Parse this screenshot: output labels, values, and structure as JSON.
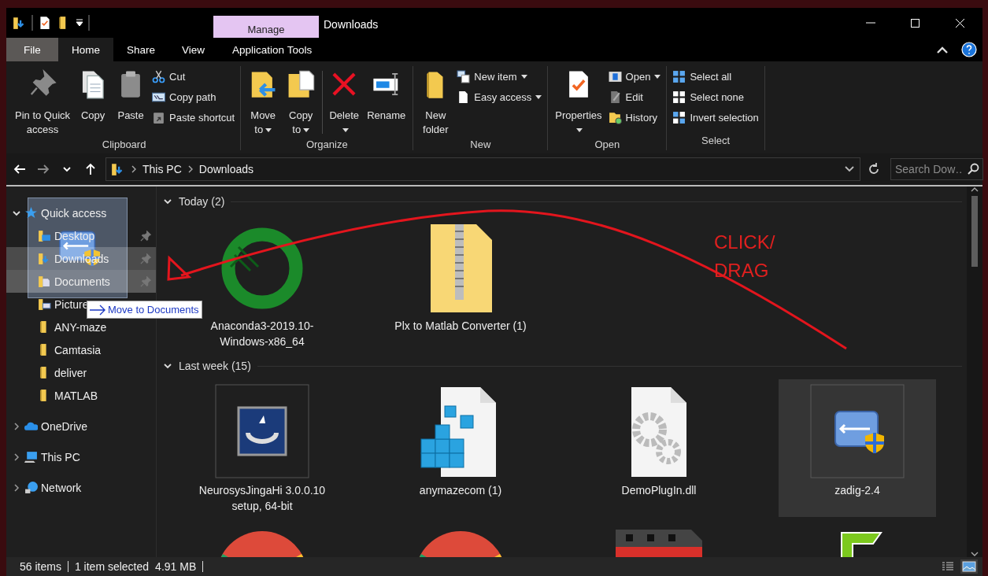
{
  "window": {
    "title": "Downloads",
    "contextual_tab": "Manage"
  },
  "ribbon_tabs": [
    {
      "label": "File",
      "kind": "file",
      "selected": false
    },
    {
      "label": "Home",
      "kind": "tab",
      "selected": true
    },
    {
      "label": "Share",
      "kind": "tab",
      "selected": false
    },
    {
      "label": "View",
      "kind": "tab",
      "selected": false
    },
    {
      "label": "Application Tools",
      "kind": "contextual",
      "selected": false
    }
  ],
  "ribbon_groups": [
    {
      "label": "Clipboard",
      "items": [
        {
          "kind": "large",
          "lines": [
            "Pin to Quick",
            "access"
          ]
        },
        {
          "kind": "large",
          "lines": [
            "Copy"
          ]
        },
        {
          "kind": "large",
          "lines": [
            "Paste"
          ]
        },
        {
          "kind": "small",
          "label": "Cut"
        },
        {
          "kind": "small",
          "label": "Copy path"
        },
        {
          "kind": "small",
          "label": "Paste shortcut"
        }
      ]
    },
    {
      "label": "Organize",
      "items": [
        {
          "kind": "large",
          "lines": [
            "Move",
            "to"
          ],
          "dropdown": true
        },
        {
          "kind": "large",
          "lines": [
            "Copy",
            "to"
          ],
          "dropdown": true
        },
        {
          "kind": "separator"
        },
        {
          "kind": "large",
          "lines": [
            "Delete"
          ],
          "dropdown": true
        },
        {
          "kind": "large",
          "lines": [
            "Rename"
          ]
        }
      ]
    },
    {
      "label": "New",
      "items": [
        {
          "kind": "large",
          "lines": [
            "New",
            "folder"
          ]
        },
        {
          "kind": "small",
          "label": "New item",
          "dropdown": true
        },
        {
          "kind": "small",
          "label": "Easy access",
          "dropdown": true
        }
      ]
    },
    {
      "label": "Open",
      "items": [
        {
          "kind": "large",
          "lines": [
            "Properties"
          ],
          "dropdown": true
        },
        {
          "kind": "small",
          "label": "Open",
          "dropdown": true
        },
        {
          "kind": "small",
          "label": "Edit"
        },
        {
          "kind": "small",
          "label": "History"
        }
      ]
    },
    {
      "label": "Select",
      "items": [
        {
          "kind": "small",
          "label": "Select all"
        },
        {
          "kind": "small",
          "label": "Select none"
        },
        {
          "kind": "small",
          "label": "Invert selection"
        }
      ]
    }
  ],
  "address_bar": {
    "path": [
      "This PC",
      "Downloads"
    ],
    "search_placeholder": "Search Dow…"
  },
  "navigation": [
    {
      "label": "Quick access",
      "expanded": true,
      "children": [
        {
          "label": "Desktop",
          "pinned": true,
          "selected": false,
          "drop_target": false
        },
        {
          "label": "Downloads",
          "pinned": true,
          "selected": true,
          "drop_target": false
        },
        {
          "label": "Documents",
          "pinned": true,
          "selected": false,
          "drop_target": true
        },
        {
          "label": "Picture",
          "pinned": false,
          "selected": false,
          "drop_target": false
        },
        {
          "label": "ANY-maze",
          "pinned": false,
          "selected": false,
          "drop_target": false
        },
        {
          "label": "Camtasia",
          "pinned": false,
          "selected": false,
          "drop_target": false
        },
        {
          "label": "deliver",
          "pinned": false,
          "selected": false,
          "drop_target": false
        },
        {
          "label": "MATLAB",
          "pinned": false,
          "selected": false,
          "drop_target": false
        }
      ]
    },
    {
      "label": "OneDrive",
      "expanded": false
    },
    {
      "label": "This PC",
      "expanded": false
    },
    {
      "label": "Network",
      "expanded": false
    }
  ],
  "file_groups": [
    {
      "label": "Today (2)",
      "expanded": true,
      "items": [
        {
          "name": "Anaconda3-2019.10-Windows-x86_64",
          "selected": false
        },
        {
          "name": "Plx to Matlab Converter (1)",
          "selected": false
        }
      ]
    },
    {
      "label": "Last week (15)",
      "expanded": true,
      "items": [
        {
          "name": "NeurosysJingaHi 3.0.0.10 setup, 64-bit",
          "selected": false
        },
        {
          "name": "anymazecom (1)",
          "selected": false
        },
        {
          "name": "DemoPlugIn.dll",
          "selected": false
        },
        {
          "name": "zadig-2.4",
          "selected": true
        },
        {
          "selected": false
        },
        {
          "selected": false
        },
        {
          "selected": false
        },
        {
          "selected": false
        }
      ]
    }
  ],
  "drag_tooltip": {
    "text": "Move to Documents"
  },
  "annotation": {
    "lines": [
      "CLICK/",
      "DRAG"
    ]
  },
  "status_bar": {
    "count": "56 items",
    "selection": "1 item selected",
    "size": "4.91 MB"
  }
}
